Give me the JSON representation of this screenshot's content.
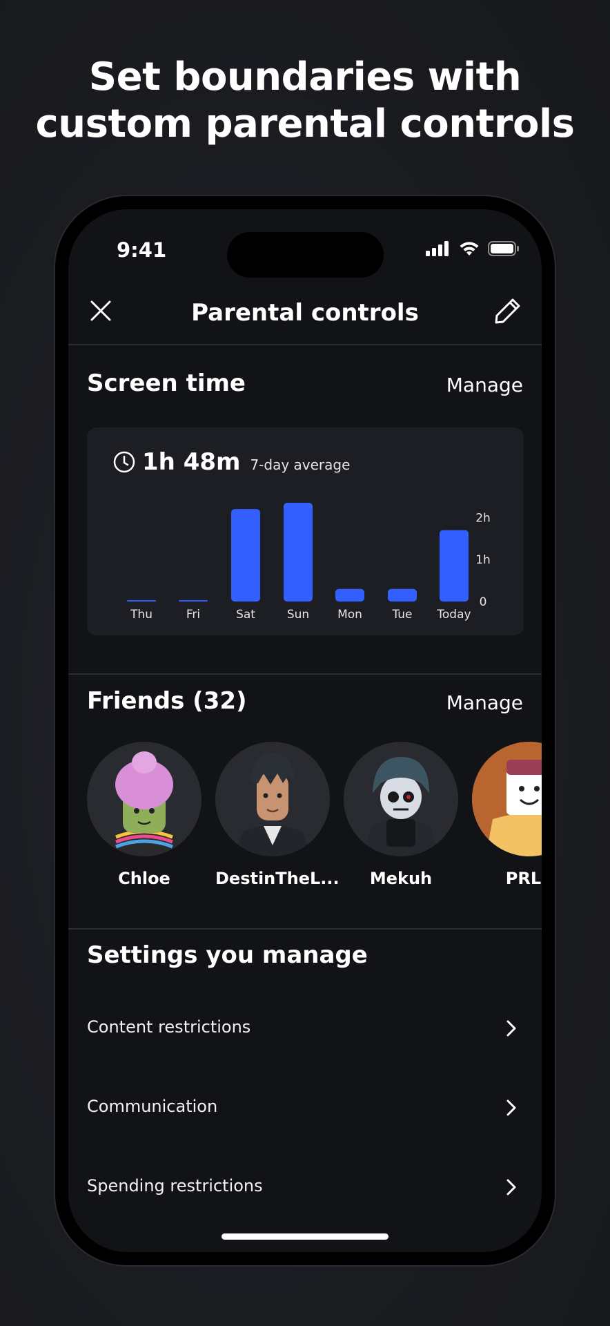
{
  "headline": {
    "line1": "Set boundaries with",
    "line2": "custom parental controls"
  },
  "status_bar": {
    "time": "9:41",
    "icons": [
      "signal-icon",
      "wifi-icon",
      "battery-icon"
    ]
  },
  "nav": {
    "title": "Parental controls",
    "close_icon": "close-icon",
    "edit_icon": "pencil-icon"
  },
  "screen_time": {
    "title": "Screen time",
    "manage_label": "Manage",
    "clock_icon": "clock-icon",
    "average_value": "1h 48m",
    "average_label": "7-day average"
  },
  "chart_data": {
    "type": "bar",
    "categories": [
      "Thu",
      "Fri",
      "Sat",
      "Sun",
      "Mon",
      "Tue",
      "Today"
    ],
    "values": [
      0.02,
      0.02,
      2.2,
      2.35,
      0.3,
      0.3,
      1.7
    ],
    "y_tick_labels": [
      "0",
      "1h",
      "2h"
    ],
    "y_ticks": [
      0,
      1,
      2
    ],
    "ylim": [
      0,
      2.4
    ],
    "bar_color": "#335fff",
    "grid": false
  },
  "friends": {
    "title": "Friends (32)",
    "manage_label": "Manage",
    "items": [
      {
        "name": "Chloe"
      },
      {
        "name": "DestinTheL..."
      },
      {
        "name": "Mekuh"
      },
      {
        "name": "PRLu"
      }
    ]
  },
  "settings": {
    "title": "Settings you manage",
    "items": [
      {
        "label": "Content restrictions"
      },
      {
        "label": "Communication"
      },
      {
        "label": "Spending restrictions"
      }
    ]
  },
  "colors": {
    "background": "#1c1d22",
    "screen": "#121317",
    "card": "#1d1e24",
    "accent": "#335fff"
  }
}
